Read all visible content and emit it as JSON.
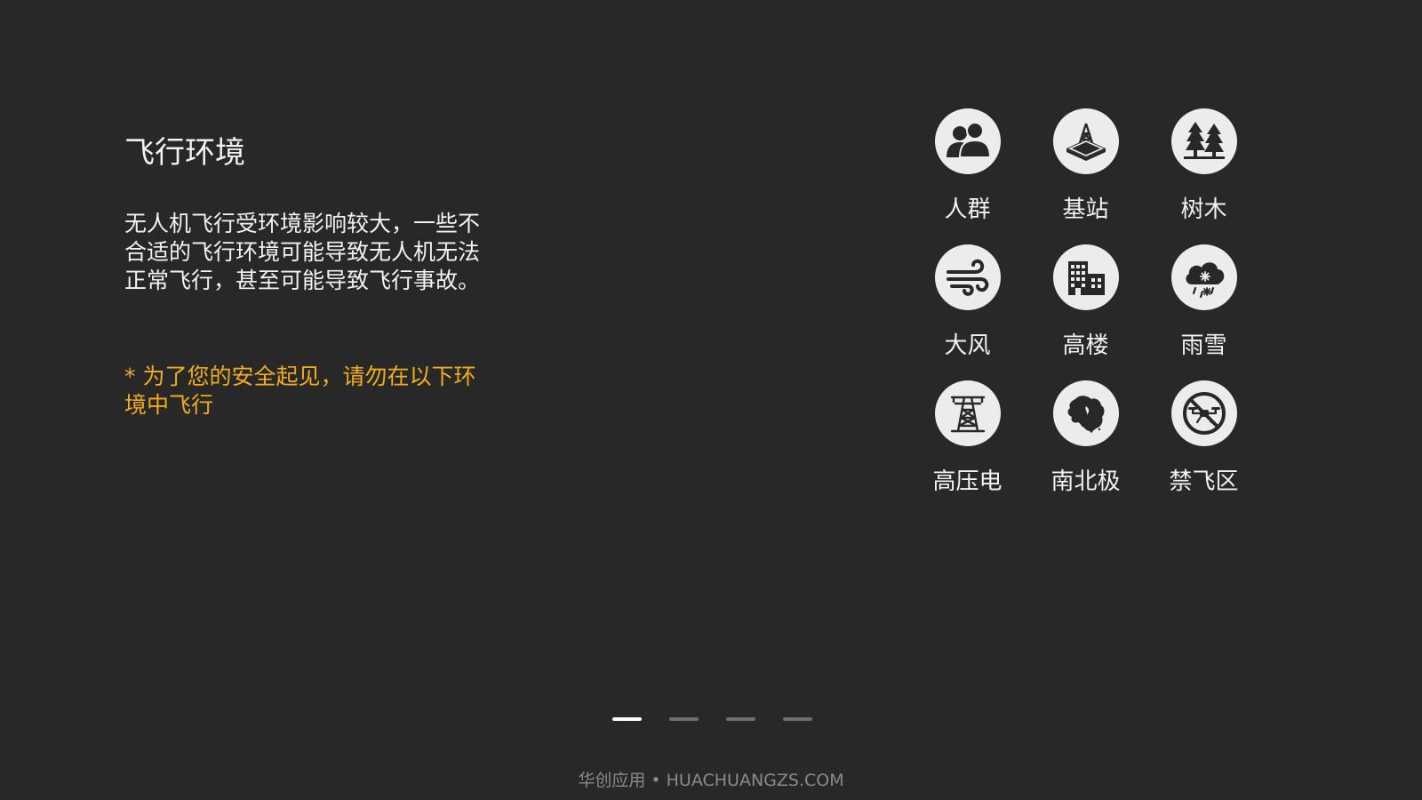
{
  "title": "飞行环境",
  "description": "无人机飞行受环境影响较大，一些不合适的飞行环境可能导致无人机无法正常飞行，甚至可能导致飞行事故。",
  "warning": "* 为了您的安全起见，请勿在以下环境中飞行",
  "environments": [
    {
      "label": "人群",
      "icon": "crowd-icon"
    },
    {
      "label": "基站",
      "icon": "base-station-icon"
    },
    {
      "label": "树木",
      "icon": "trees-icon"
    },
    {
      "label": "大风",
      "icon": "wind-icon"
    },
    {
      "label": "高楼",
      "icon": "buildings-icon"
    },
    {
      "label": "雨雪",
      "icon": "rain-snow-icon"
    },
    {
      "label": "高压电",
      "icon": "power-tower-icon"
    },
    {
      "label": "南北极",
      "icon": "polar-region-icon"
    },
    {
      "label": "禁飞区",
      "icon": "no-fly-zone-icon"
    }
  ],
  "pager": {
    "total": 4,
    "active_index": 0
  },
  "footer": "华创应用 • HUACHUANGZS.COM",
  "colors": {
    "background": "#282828",
    "text": "#f2f2f2",
    "warning": "#f0ac1c",
    "icon_background": "#ececec",
    "icon_foreground": "#282828",
    "pager_active": "#ffffff",
    "pager_inactive": "#6f6f6f",
    "footer_text": "#8a8a8a"
  }
}
